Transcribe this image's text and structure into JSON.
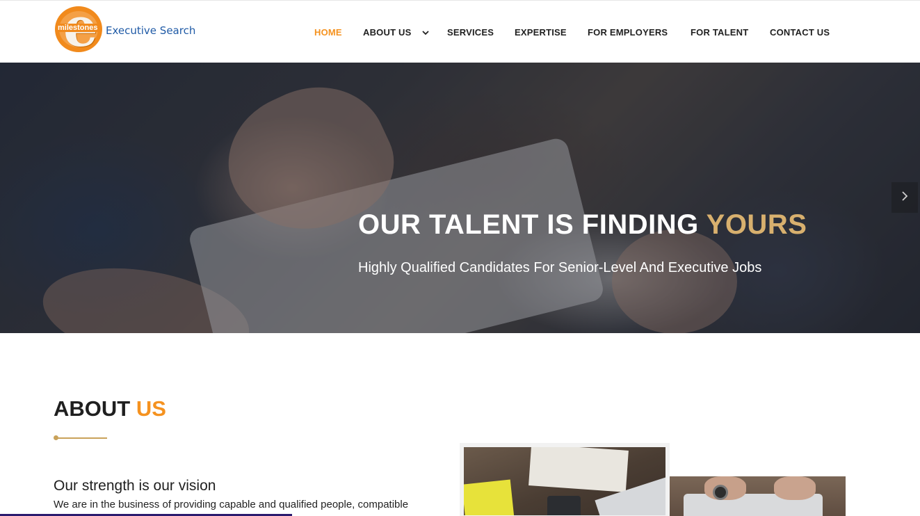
{
  "brand": {
    "logo_letter": "e",
    "logo_tag": "milestones",
    "name": "Executive Search"
  },
  "nav": {
    "items": [
      {
        "label": "HOME",
        "active": true
      },
      {
        "label": "ABOUT US",
        "has_dropdown": true
      },
      {
        "label": "SERVICES"
      },
      {
        "label": "EXPERTISE"
      },
      {
        "label": "FOR EMPLOYERS"
      },
      {
        "label": "FOR TALENT"
      },
      {
        "label": "CONTACT US"
      }
    ],
    "dropdown_icon": "chevron-down-icon"
  },
  "hero": {
    "title_main": "OUR TALENT IS FINDING",
    "title_highlight": "YOURS",
    "subtitle": "Highly Qualified Candidates For Senior-Level And Executive Jobs",
    "next_icon": "chevron-right-icon"
  },
  "about": {
    "title_main": "ABOUT",
    "title_highlight": "US",
    "subtitle": "Our strength is our vision",
    "body": "We are in the business of providing capable and qualified people, compatible"
  },
  "colors": {
    "accent": "#f5921f",
    "hero_highlight": "#d8b06e",
    "divider": "#c9a25a",
    "brand_blue": "#1f5aa6"
  }
}
